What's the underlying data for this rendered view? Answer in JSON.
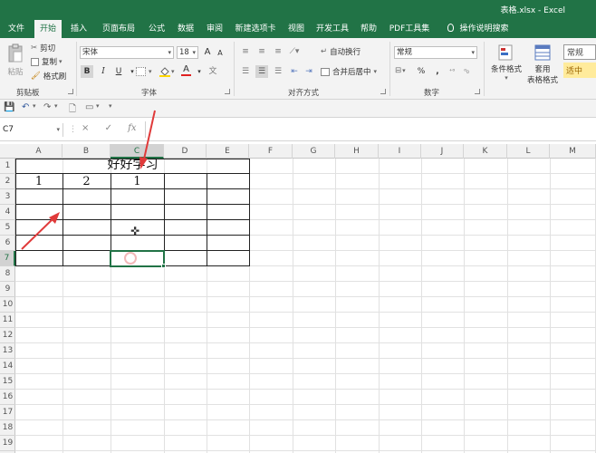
{
  "window": {
    "title": "表格.xlsx  -  Excel"
  },
  "tabs": [
    {
      "label": "文件",
      "active": false
    },
    {
      "label": "开始",
      "active": true
    },
    {
      "label": "插入",
      "active": false
    },
    {
      "label": "页面布局",
      "active": false
    },
    {
      "label": "公式",
      "active": false
    },
    {
      "label": "数据",
      "active": false
    },
    {
      "label": "审阅",
      "active": false
    },
    {
      "label": "新建选项卡",
      "active": false
    },
    {
      "label": "视图",
      "active": false
    },
    {
      "label": "开发工具",
      "active": false
    },
    {
      "label": "帮助",
      "active": false
    },
    {
      "label": "PDF工具集",
      "active": false
    },
    {
      "label": "操作说明搜索",
      "active": false
    }
  ],
  "ribbon": {
    "clipboard": {
      "paste": "粘贴",
      "cut": "剪切",
      "copy": "复制",
      "format_painter": "格式刷",
      "group": "剪贴板"
    },
    "font": {
      "name": "宋体",
      "size": "18",
      "bold": "B",
      "italic": "I",
      "underline": "U",
      "grow": "A",
      "shrink": "A",
      "color_letter": "A",
      "group": "字体"
    },
    "alignment": {
      "wrap": "自动换行",
      "merge": "合并后居中",
      "group": "对齐方式"
    },
    "number": {
      "format": "常规",
      "percent": "%",
      "comma": ",",
      "group": "数字"
    },
    "styles": {
      "conditional": "条件格式",
      "table_format_1": "套用",
      "table_format_2": "表格格式",
      "normal": "常规",
      "good": "适中"
    }
  },
  "formula_bar": {
    "name_box": "C7",
    "cancel": "×",
    "enter": "✓",
    "fx": "fx",
    "value": ""
  },
  "columns": [
    "A",
    "B",
    "C",
    "D",
    "E",
    "F",
    "G",
    "H",
    "I",
    "J",
    "K",
    "L",
    "M"
  ],
  "rows": [
    "1",
    "2",
    "3",
    "4",
    "5",
    "6",
    "7",
    "8",
    "9",
    "10",
    "11",
    "12",
    "13",
    "14",
    "15",
    "16",
    "17",
    "18",
    "19"
  ],
  "selected": {
    "col": "C",
    "row": "7"
  },
  "cells": {
    "title": "好好学习",
    "a2": "1",
    "b2": "2",
    "c2": "1"
  },
  "colors": {
    "excel_green": "#217346",
    "annotation_red": "#e03a3a",
    "selection_green": "#217346"
  }
}
